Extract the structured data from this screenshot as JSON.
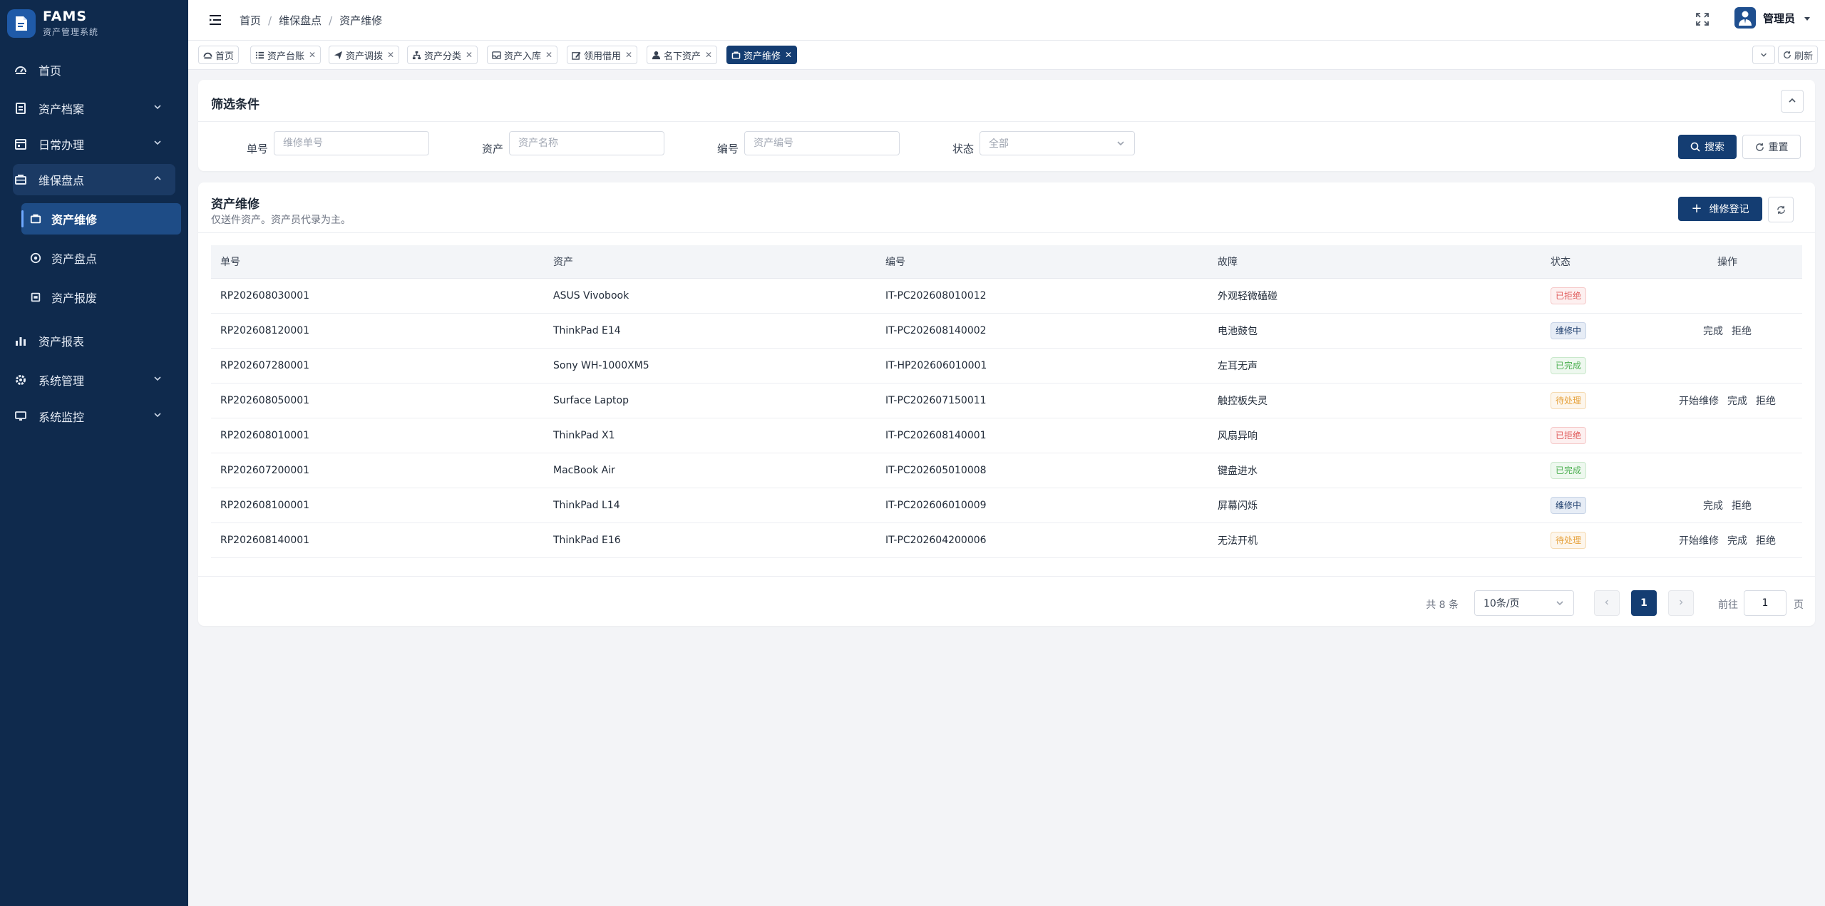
{
  "brand": {
    "title": "FAMS",
    "subtitle": "资产管理系统"
  },
  "sidebar": {
    "items": [
      {
        "label": "首页",
        "icon": "dashboard-icon"
      },
      {
        "label": "资产档案",
        "icon": "archive-icon"
      },
      {
        "label": "日常办理",
        "icon": "calendar-icon"
      },
      {
        "label": "维保盘点",
        "icon": "toolbox-icon"
      },
      {
        "label": "资产报表",
        "icon": "bar-chart-icon"
      },
      {
        "label": "系统管理",
        "icon": "gear-icon"
      },
      {
        "label": "系统监控",
        "icon": "monitor-icon"
      }
    ],
    "subitems": [
      {
        "label": "资产维修",
        "icon": "toolbox-icon"
      },
      {
        "label": "资产盘点",
        "icon": "target-icon"
      },
      {
        "label": "资产报废",
        "icon": "trash-box-icon"
      }
    ]
  },
  "header": {
    "breadcrumb": [
      "首页",
      "维保盘点",
      "资产维修"
    ],
    "user": "管理员"
  },
  "tabs": [
    {
      "label": "首页",
      "icon": "dashboard-icon",
      "closable": false
    },
    {
      "label": "资产台账",
      "icon": "list-icon",
      "closable": true
    },
    {
      "label": "资产调拨",
      "icon": "send-icon",
      "closable": true
    },
    {
      "label": "资产分类",
      "icon": "tree-icon",
      "closable": true
    },
    {
      "label": "资产入库",
      "icon": "inbox-icon",
      "closable": true
    },
    {
      "label": "领用借用",
      "icon": "edit-icon",
      "closable": true
    },
    {
      "label": "名下资产",
      "icon": "user-icon",
      "closable": true
    },
    {
      "label": "资产维修",
      "icon": "toolbox-icon",
      "closable": true,
      "active": true
    }
  ],
  "tabs_refresh": "刷新",
  "filter": {
    "title": "筛选条件",
    "fields": [
      {
        "label": "单号",
        "placeholder": "维修单号"
      },
      {
        "label": "资产",
        "placeholder": "资产名称"
      },
      {
        "label": "编号",
        "placeholder": "资产编号"
      }
    ],
    "status_label": "状态",
    "status_value": "全部",
    "search": "搜索",
    "reset": "重置"
  },
  "table": {
    "title": "资产维修",
    "subtitle": "仅送件资产。资产员代录为主。",
    "add_button": "维修登记",
    "columns": [
      "单号",
      "资产",
      "编号",
      "故障",
      "状态",
      "操作"
    ],
    "rows": [
      {
        "id": "RP202608030001",
        "asset": "ASUS Vivobook",
        "code": "IT-PC202608010012",
        "fault": "外观轻微磕碰",
        "status": "已拒绝",
        "actions": []
      },
      {
        "id": "RP202608120001",
        "asset": "ThinkPad E14",
        "code": "IT-PC202608140002",
        "fault": "电池鼓包",
        "status": "维修中",
        "actions": [
          "完成",
          "拒绝"
        ]
      },
      {
        "id": "RP202607280001",
        "asset": "Sony WH-1000XM5",
        "code": "IT-HP202606010001",
        "fault": "左耳无声",
        "status": "已完成",
        "actions": []
      },
      {
        "id": "RP202608050001",
        "asset": "Surface Laptop",
        "code": "IT-PC202607150011",
        "fault": "触控板失灵",
        "status": "待处理",
        "actions": [
          "开始维修",
          "完成",
          "拒绝"
        ]
      },
      {
        "id": "RP202608010001",
        "asset": "ThinkPad X1",
        "code": "IT-PC202608140001",
        "fault": "风扇异响",
        "status": "已拒绝",
        "actions": []
      },
      {
        "id": "RP202607200001",
        "asset": "MacBook Air",
        "code": "IT-PC202605010008",
        "fault": "键盘进水",
        "status": "已完成",
        "actions": []
      },
      {
        "id": "RP202608100001",
        "asset": "ThinkPad L14",
        "code": "IT-PC202606010009",
        "fault": "屏幕闪烁",
        "status": "维修中",
        "actions": [
          "完成",
          "拒绝"
        ]
      },
      {
        "id": "RP202608140001",
        "asset": "ThinkPad E16",
        "code": "IT-PC202604200006",
        "fault": "无法开机",
        "status": "待处理",
        "actions": [
          "开始维修",
          "完成",
          "拒绝"
        ]
      }
    ]
  },
  "status_colors": {
    "已拒绝": {
      "fg": "#e05a5a",
      "bg": "#fdf0f0",
      "border": "#f6c9c9"
    },
    "维修中": {
      "fg": "#1f3f6e",
      "bg": "#e7edf6",
      "border": "#c7d3e6"
    },
    "已完成": {
      "fg": "#4caf50",
      "bg": "#eef8ef",
      "border": "#c9e8cb"
    },
    "待处理": {
      "fg": "#e6a23c",
      "bg": "#fdf6ec",
      "border": "#f5dab1"
    }
  },
  "pagination": {
    "total": "共 8 条",
    "page_size": "10条/页",
    "current": "1",
    "goto_label": "前往",
    "goto_value": "1",
    "page_suffix": "页"
  },
  "colors": {
    "sidebar": "#0f2a4d",
    "primary": "#143d72",
    "background": "#f3f4f7"
  }
}
